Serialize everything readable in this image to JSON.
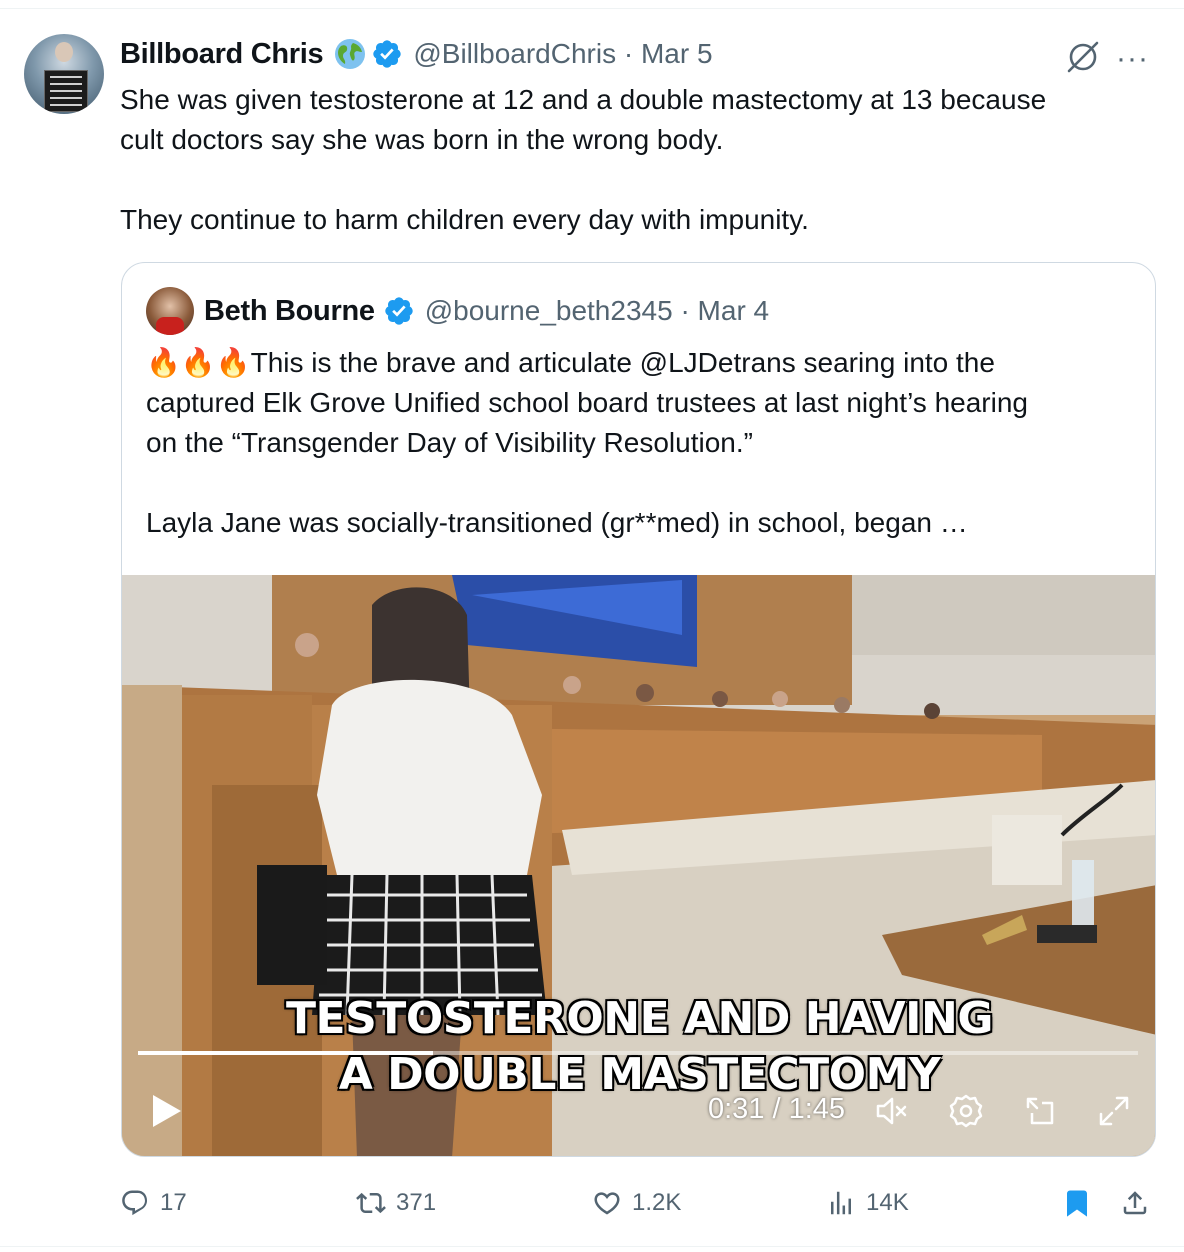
{
  "tweet": {
    "author_name": "Billboard Chris",
    "handle_date": "@BillboardChris · Mar 5",
    "text": "She was given testosterone at 12 and a double mastectomy at 13 because\ncult doctors say she was born in the wrong body.\n\nThey continue to harm children every day with impunity.",
    "more_label": "···"
  },
  "quote": {
    "author_name": "Beth Bourne",
    "handle_date": "@bourne_beth2345 · Mar 4",
    "text": "🔥🔥🔥This is the brave and articulate @LJDetrans searing into the\ncaptured Elk Grove Unified school board trustees at last night’s hearing\non the “Transgender Day of Visibility Resolution.”\n\nLayla Jane was socially-transitioned (gr**med) in school, began …"
  },
  "video": {
    "caption_line1": "TESTOSTERONE AND HAVING",
    "caption_line2": "A DOUBLE MASTECTOMY",
    "time": "0:31 / 1:45",
    "progress": 0.295,
    "muted": true
  },
  "actions": {
    "replies": "17",
    "reposts": "371",
    "likes": "1.2K",
    "views": "14K",
    "bookmarked": true
  },
  "colors": {
    "text": "#0f1419",
    "secondary": "#536471",
    "verified_blue": "#1d9bf0",
    "bookmark_blue": "#1d9bf0",
    "border": "#cfd9e2"
  },
  "icons": [
    "globe-emoji-icon",
    "verified-badge-icon",
    "grok-icon",
    "more-icon",
    "play-icon",
    "mute-icon",
    "settings-icon",
    "pip-icon",
    "fullscreen-icon",
    "reply-icon",
    "repost-icon",
    "like-icon",
    "views-icon",
    "bookmark-icon",
    "share-icon"
  ]
}
